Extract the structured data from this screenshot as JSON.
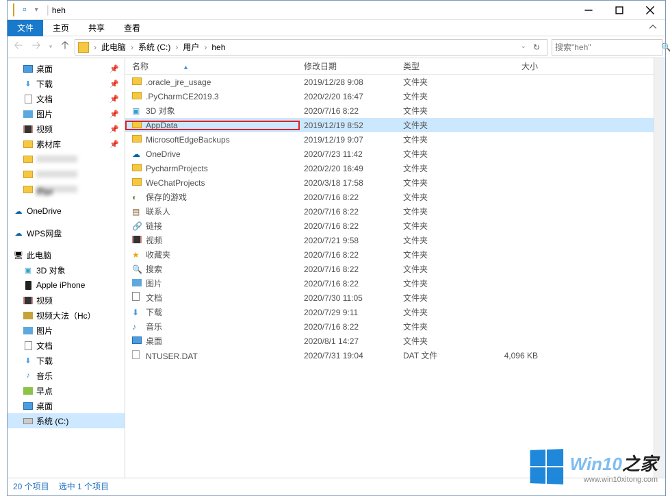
{
  "window": {
    "title": "heh"
  },
  "ribbon": {
    "file": "文件",
    "home": "主页",
    "share": "共享",
    "view": "查看"
  },
  "breadcrumb": {
    "items": [
      "此电脑",
      "系统 (C:)",
      "用户",
      "heh"
    ]
  },
  "search": {
    "placeholder": "搜索\"heh\""
  },
  "columns": {
    "name": "名称",
    "date": "修改日期",
    "type": "类型",
    "size": "大小"
  },
  "sidebar": {
    "quick": [
      {
        "label": "桌面",
        "icon": "desktop",
        "pinned": true
      },
      {
        "label": "下载",
        "icon": "download",
        "pinned": true
      },
      {
        "label": "文档",
        "icon": "document",
        "pinned": true
      },
      {
        "label": "图片",
        "icon": "picture",
        "pinned": true
      },
      {
        "label": "视频",
        "icon": "video",
        "pinned": true
      },
      {
        "label": "素材库",
        "icon": "folder",
        "pinned": true
      },
      {
        "label": "",
        "icon": "folder",
        "blurred": true
      },
      {
        "label": "",
        "icon": "folder",
        "blurred": true
      },
      {
        "label": "的ipl",
        "icon": "folder",
        "blurred": true
      }
    ],
    "cloud": [
      {
        "label": "OneDrive",
        "icon": "onedrive"
      },
      {
        "label": "WPS网盘",
        "icon": "wps"
      }
    ],
    "thispc_label": "此电脑",
    "thispc": [
      {
        "label": "3D 对象",
        "icon": "3d"
      },
      {
        "label": "Apple iPhone",
        "icon": "phone"
      },
      {
        "label": "视频",
        "icon": "video"
      },
      {
        "label": "视频大法（Hc）",
        "icon": "video2"
      },
      {
        "label": "图片",
        "icon": "picture"
      },
      {
        "label": "文档",
        "icon": "document"
      },
      {
        "label": "下载",
        "icon": "download"
      },
      {
        "label": "音乐",
        "icon": "music"
      },
      {
        "label": "早点",
        "icon": "folder-g"
      },
      {
        "label": "桌面",
        "icon": "desktop"
      },
      {
        "label": "系统 (C:)",
        "icon": "drive",
        "selected": true
      }
    ]
  },
  "files": [
    {
      "name": ".oracle_jre_usage",
      "date": "2019/12/28 9:08",
      "type": "文件夹",
      "size": "",
      "icon": "folder"
    },
    {
      "name": ".PyCharmCE2019.3",
      "date": "2020/2/20 16:47",
      "type": "文件夹",
      "size": "",
      "icon": "folder"
    },
    {
      "name": "3D 对象",
      "date": "2020/7/16 8:22",
      "type": "文件夹",
      "size": "",
      "icon": "3d"
    },
    {
      "name": "AppData",
      "date": "2019/12/19 8:52",
      "type": "文件夹",
      "size": "",
      "icon": "folder",
      "selected": true,
      "highlighted": true
    },
    {
      "name": "MicrosoftEdgeBackups",
      "date": "2019/12/19 9:07",
      "type": "文件夹",
      "size": "",
      "icon": "folder"
    },
    {
      "name": "OneDrive",
      "date": "2020/7/23 11:42",
      "type": "文件夹",
      "size": "",
      "icon": "onedrive"
    },
    {
      "name": "PycharmProjects",
      "date": "2020/2/20 16:49",
      "type": "文件夹",
      "size": "",
      "icon": "folder"
    },
    {
      "name": "WeChatProjects",
      "date": "2020/3/18 17:58",
      "type": "文件夹",
      "size": "",
      "icon": "folder"
    },
    {
      "name": "保存的游戏",
      "date": "2020/7/16 8:22",
      "type": "文件夹",
      "size": "",
      "icon": "games"
    },
    {
      "name": "联系人",
      "date": "2020/7/16 8:22",
      "type": "文件夹",
      "size": "",
      "icon": "contacts"
    },
    {
      "name": "链接",
      "date": "2020/7/16 8:22",
      "type": "文件夹",
      "size": "",
      "icon": "links"
    },
    {
      "name": "视频",
      "date": "2020/7/21 9:58",
      "type": "文件夹",
      "size": "",
      "icon": "video"
    },
    {
      "name": "收藏夹",
      "date": "2020/7/16 8:22",
      "type": "文件夹",
      "size": "",
      "icon": "favorites"
    },
    {
      "name": "搜索",
      "date": "2020/7/16 8:22",
      "type": "文件夹",
      "size": "",
      "icon": "search"
    },
    {
      "name": "图片",
      "date": "2020/7/16 8:22",
      "type": "文件夹",
      "size": "",
      "icon": "picture"
    },
    {
      "name": "文档",
      "date": "2020/7/30 11:05",
      "type": "文件夹",
      "size": "",
      "icon": "document"
    },
    {
      "name": "下载",
      "date": "2020/7/29 9:11",
      "type": "文件夹",
      "size": "",
      "icon": "download"
    },
    {
      "name": "音乐",
      "date": "2020/7/16 8:22",
      "type": "文件夹",
      "size": "",
      "icon": "music"
    },
    {
      "name": "桌面",
      "date": "2020/8/1 14:27",
      "type": "文件夹",
      "size": "",
      "icon": "desktop"
    },
    {
      "name": "NTUSER.DAT",
      "date": "2020/7/31 19:04",
      "type": "DAT 文件",
      "size": "4,096 KB",
      "icon": "file"
    }
  ],
  "statusbar": {
    "items": "20 个项目",
    "selected": "选中 1 个项目"
  },
  "watermark": {
    "title_a": "Win10",
    "title_b": "之家",
    "url": "www.win10xitong.com"
  }
}
